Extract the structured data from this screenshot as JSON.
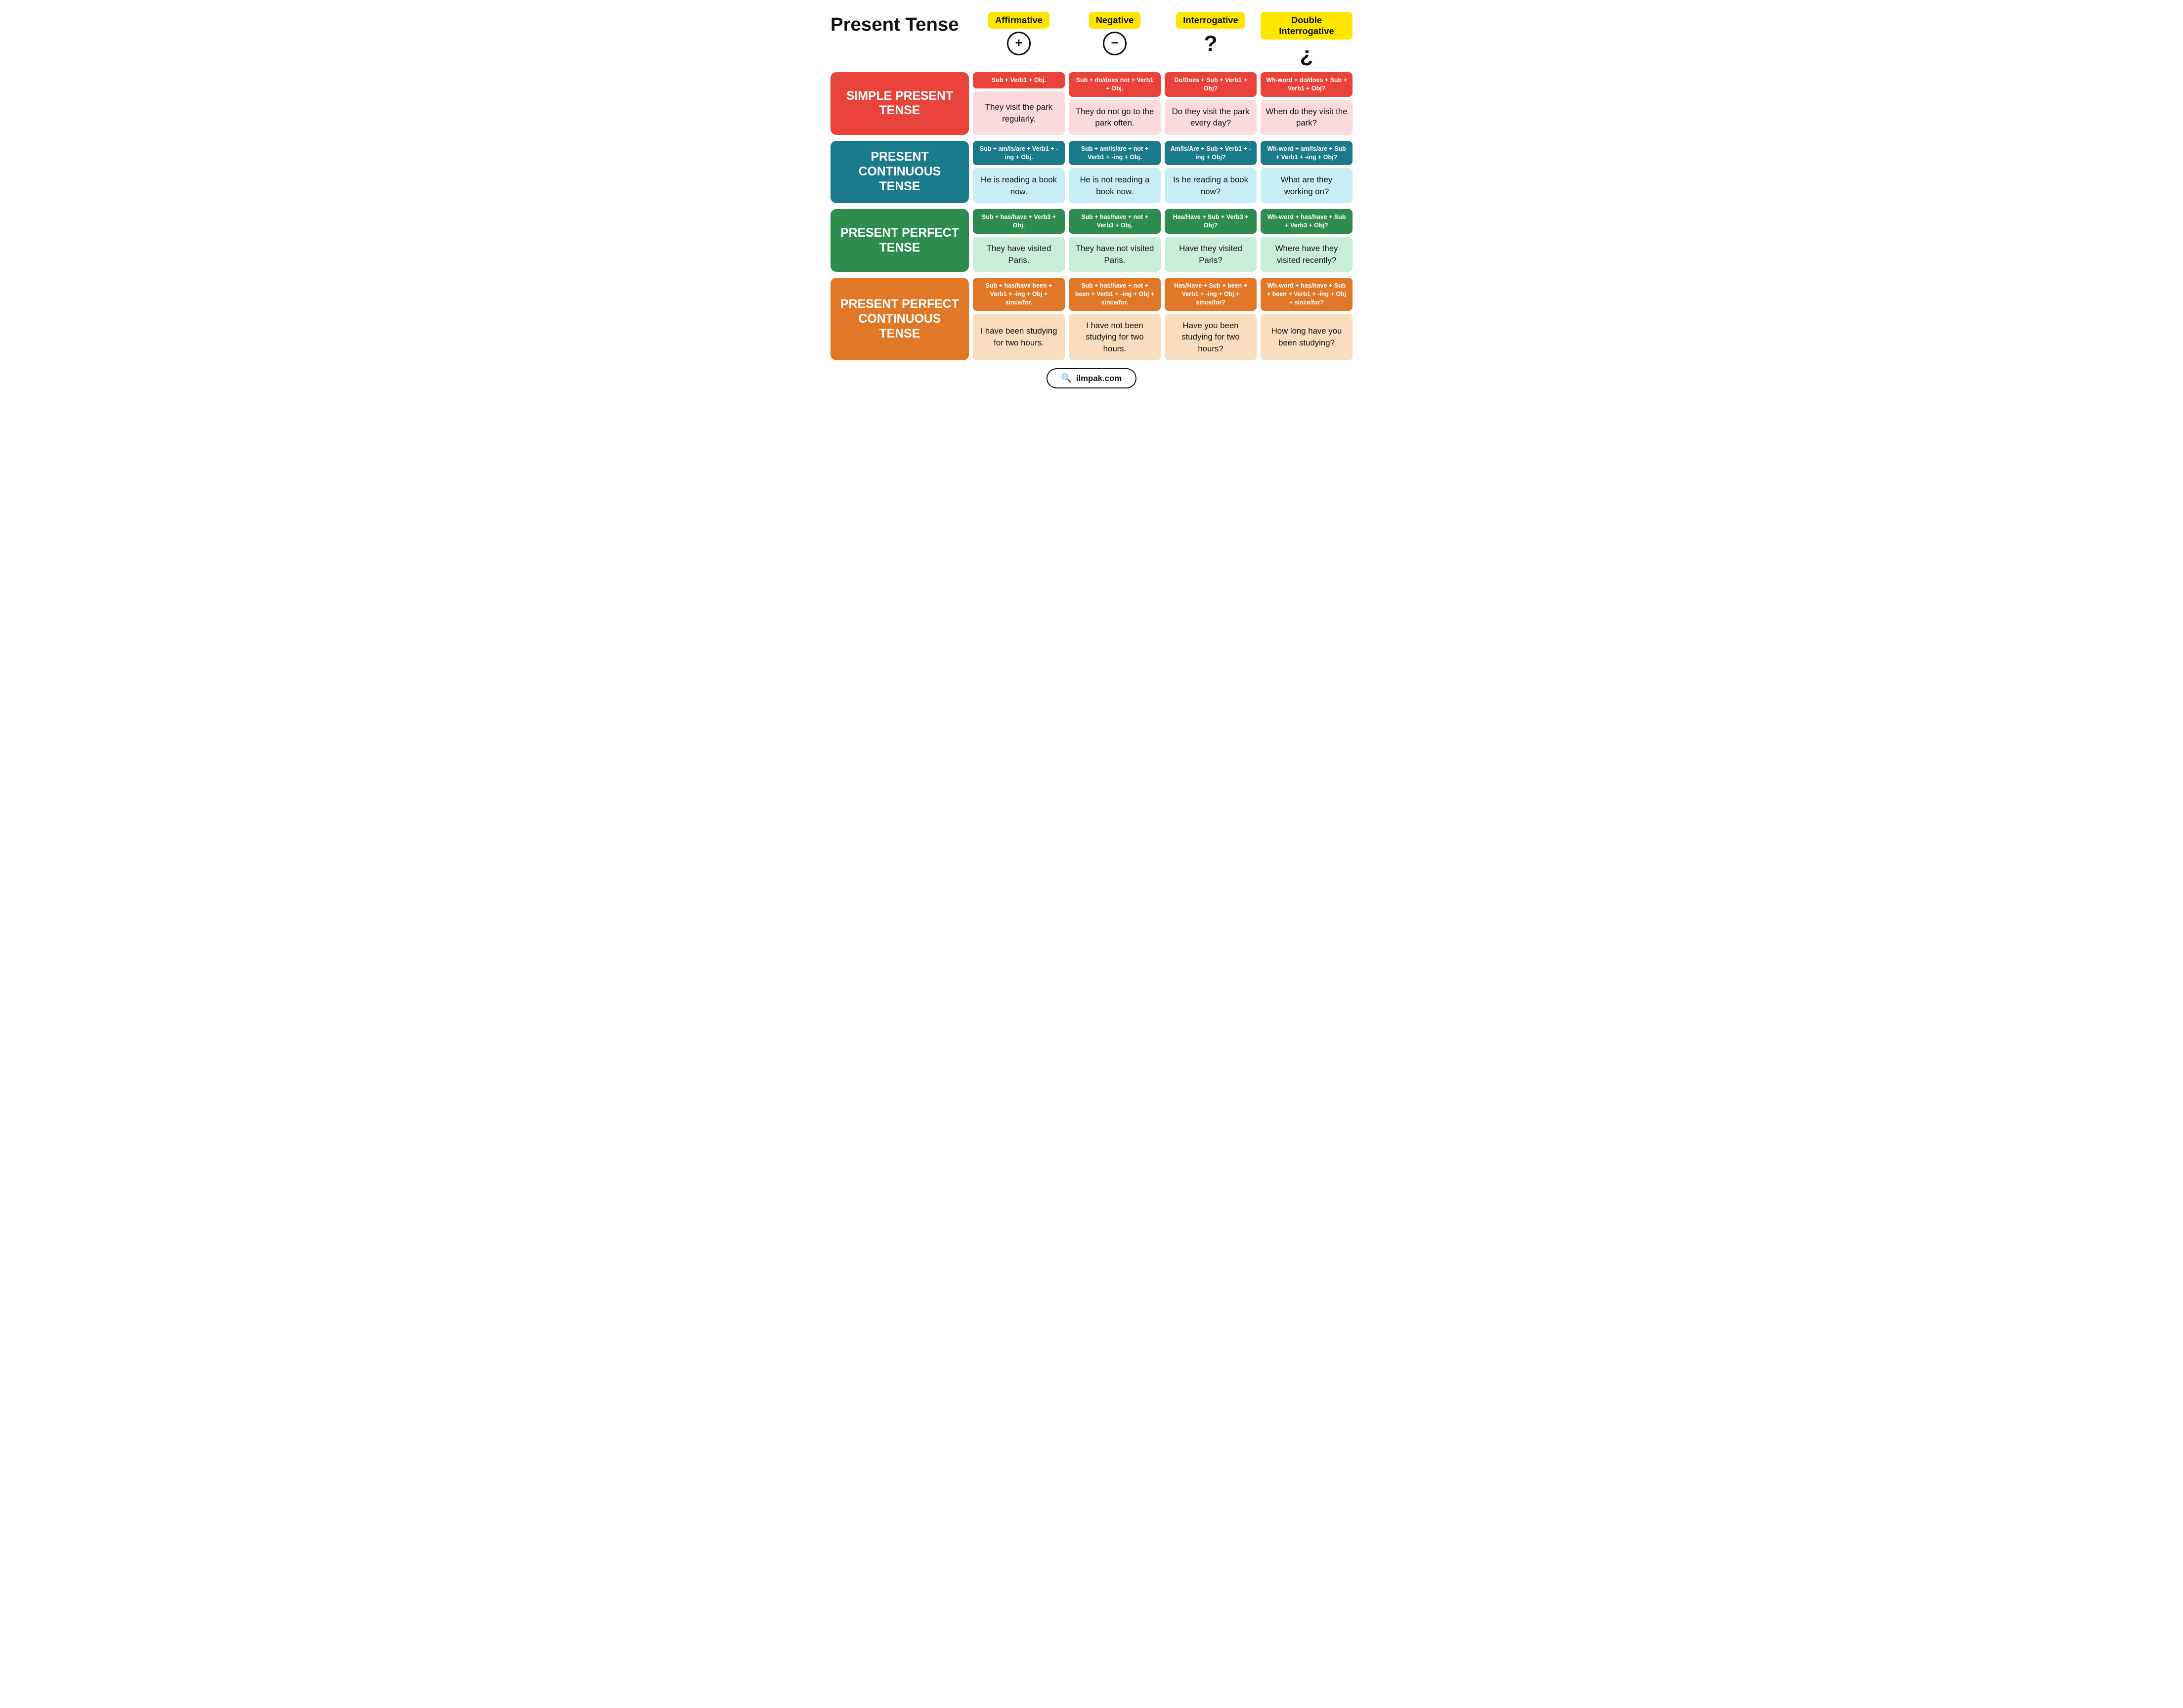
{
  "title": "Present Tense",
  "columns": [
    {
      "label": "Affirmative",
      "icon_type": "circle",
      "icon_text": "+",
      "color_class": "yellow"
    },
    {
      "label": "Negative",
      "icon_type": "circle",
      "icon_text": "−",
      "color_class": "yellow"
    },
    {
      "label": "Interrogative",
      "icon_type": "text",
      "icon_text": "?",
      "color_class": "yellow"
    },
    {
      "label": "Double Interrogative",
      "icon_type": "text",
      "icon_text": "¿",
      "color_class": "yellow"
    }
  ],
  "rows": [
    {
      "label": "SIMPLE PRESENT TENSE",
      "label_color": "red",
      "cells": [
        {
          "formula": "Sub + Verb1 + Obj.",
          "example": "They visit the park regularly.",
          "formula_color": "red-formula",
          "example_color": "pink"
        },
        {
          "formula": "Sub + do/does not + Verb1 + Obj.",
          "example": "They do not go to the park often.",
          "formula_color": "red-formula",
          "example_color": "pink"
        },
        {
          "formula": "Do/Does + Sub + Verb1 + Obj?",
          "example": "Do they visit the park every day?",
          "formula_color": "red-formula",
          "example_color": "pink"
        },
        {
          "formula": "Wh-word + do/does + Sub + Verb1 + Obj?",
          "example": "When do they visit the park?",
          "formula_color": "red-formula",
          "example_color": "pink"
        }
      ]
    },
    {
      "label": "PRESENT CONTINUOUS TENSE",
      "label_color": "teal",
      "cells": [
        {
          "formula": "Sub + am/is/are + Verb1 + -ing + Obj.",
          "example": "He is reading a book now.",
          "formula_color": "teal-formula",
          "example_color": "light-blue"
        },
        {
          "formula": "Sub + am/is/are + not + Verb1 + -ing + Obj.",
          "example": "He is not reading a book now.",
          "formula_color": "teal-formula",
          "example_color": "light-blue"
        },
        {
          "formula": "Am/Is/Are + Sub + Verb1 + -ing + Obj?",
          "example": "Is he reading a book now?",
          "formula_color": "teal-formula",
          "example_color": "light-blue"
        },
        {
          "formula": "Wh-word + am/is/are + Sub + Verb1 + -ing + Obj?",
          "example": "What are they working on?",
          "formula_color": "teal-formula",
          "example_color": "light-blue"
        }
      ]
    },
    {
      "label": "PRESENT PERFECT TENSE",
      "label_color": "green",
      "cells": [
        {
          "formula": "Sub + has/have + Verb3 + Obj.",
          "example": "They have visited Paris.",
          "formula_color": "green-formula",
          "example_color": "light-green"
        },
        {
          "formula": "Sub + has/have + not + Verb3 + Obj.",
          "example": "They have not visited Paris.",
          "formula_color": "green-formula",
          "example_color": "light-green"
        },
        {
          "formula": "Has/Have + Sub + Verb3 + Obj?",
          "example": "Have they visited Paris?",
          "formula_color": "green-formula",
          "example_color": "light-green"
        },
        {
          "formula": "Wh-word + has/have + Sub + Verb3 + Obj?",
          "example": "Where have they visited recently?",
          "formula_color": "green-formula",
          "example_color": "light-green"
        }
      ]
    },
    {
      "label": "PRESENT PERFECT CONTINUOUS TENSE",
      "label_color": "orange",
      "cells": [
        {
          "formula": "Sub + has/have been + Verb1 + -ing + Obj + since/for.",
          "example": "I have been studying for two hours.",
          "formula_color": "orange-formula",
          "example_color": "light-orange"
        },
        {
          "formula": "Sub + has/have + not + been + Verb1 + -ing + Obj + since/for.",
          "example": "I have not been studying for two hours.",
          "formula_color": "orange-formula",
          "example_color": "light-orange"
        },
        {
          "formula": "Has/Have + Sub + been + Verb1 + -ing + Obj + since/for?",
          "example": "Have you been studying for two hours?",
          "formula_color": "orange-formula",
          "example_color": "light-orange"
        },
        {
          "formula": "Wh-word + has/have + Sub + been + Verb1 + -ing + Obj + since/for?",
          "example": "How long have you been studying?",
          "formula_color": "orange-formula",
          "example_color": "light-orange"
        }
      ]
    }
  ],
  "footer": {
    "text": "ilmpak.com",
    "search_icon": "🔍"
  }
}
